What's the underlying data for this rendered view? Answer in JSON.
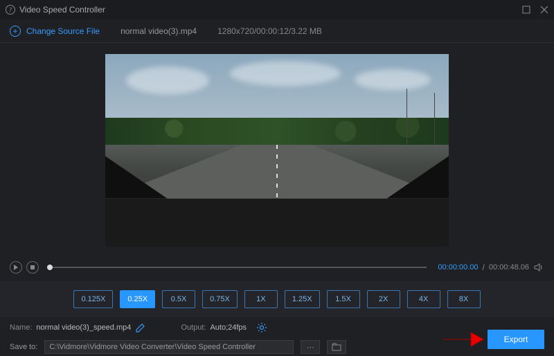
{
  "titlebar": {
    "title": "Video Speed Controller"
  },
  "change_source": {
    "label": "Change Source File"
  },
  "source": {
    "filename": "normal video(3).mp4",
    "meta": "1280x720/00:00:12/3.22 MB"
  },
  "playback": {
    "current_time": "00:00:00.00",
    "duration": "00:00:48.06"
  },
  "speeds": {
    "options": [
      "0.125X",
      "0.25X",
      "0.5X",
      "0.75X",
      "1X",
      "1.25X",
      "1.5X",
      "2X",
      "4X",
      "8X"
    ],
    "active": "0.25X"
  },
  "name": {
    "label": "Name:",
    "value": "normal video(3)_speed.mp4"
  },
  "output": {
    "label": "Output:",
    "value": "Auto;24fps"
  },
  "save": {
    "label": "Save to:",
    "path": "C:\\Vidmore\\Vidmore Video Converter\\Video Speed Controller"
  },
  "export": {
    "label": "Export"
  }
}
